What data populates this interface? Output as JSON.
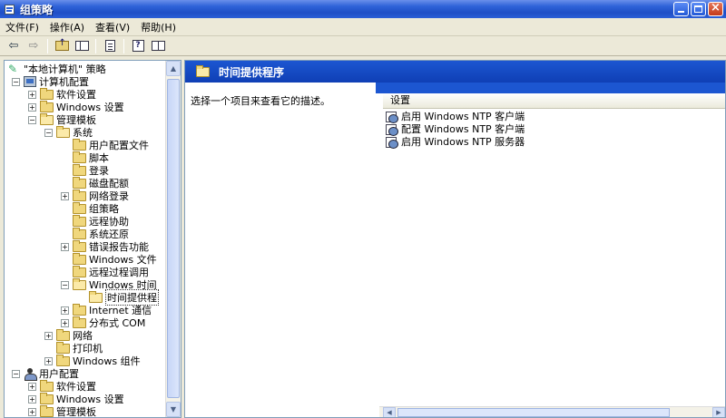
{
  "window": {
    "title": "组策略"
  },
  "menu": [
    "文件(F)",
    "操作(A)",
    "查看(V)",
    "帮助(H)"
  ],
  "toolbar": {
    "back_icon": "back-arrow-icon",
    "forward_icon": "forward-arrow-icon",
    "back_glyph": "⇦",
    "forward_glyph": "⇨"
  },
  "tree": [
    {
      "label": "\"本地计算机\" 策略",
      "icon": "policy"
    },
    {
      "label": "计算机配置",
      "icon": "computer"
    },
    {
      "label": "软件设置",
      "icon": "folder"
    },
    {
      "label": "Windows 设置",
      "icon": "folder"
    },
    {
      "label": "管理模板",
      "icon": "folder"
    },
    {
      "label": "系统",
      "icon": "folder"
    },
    {
      "label": "用户配置文件",
      "icon": "folder"
    },
    {
      "label": "脚本",
      "icon": "folder"
    },
    {
      "label": "登录",
      "icon": "folder"
    },
    {
      "label": "磁盘配额",
      "icon": "folder"
    },
    {
      "label": "网络登录",
      "icon": "folder"
    },
    {
      "label": "组策略",
      "icon": "folder"
    },
    {
      "label": "远程协助",
      "icon": "folder"
    },
    {
      "label": "系统还原",
      "icon": "folder"
    },
    {
      "label": "错误报告功能",
      "icon": "folder"
    },
    {
      "label": "Windows 文件",
      "icon": "folder"
    },
    {
      "label": "远程过程调用",
      "icon": "folder"
    },
    {
      "label": "Windows 时间",
      "icon": "folder"
    },
    {
      "label": "时间提供程",
      "icon": "folder-open"
    },
    {
      "label": "Internet 通信",
      "icon": "folder"
    },
    {
      "label": "分布式 COM",
      "icon": "folder"
    },
    {
      "label": "网络",
      "icon": "folder"
    },
    {
      "label": "打印机",
      "icon": "folder"
    },
    {
      "label": "Windows 组件",
      "icon": "folder"
    },
    {
      "label": "用户配置",
      "icon": "user"
    },
    {
      "label": "软件设置",
      "icon": "folder"
    },
    {
      "label": "Windows 设置",
      "icon": "folder"
    },
    {
      "label": "管理模板",
      "icon": "folder"
    }
  ],
  "right": {
    "header_title": "时间提供程序",
    "description": "选择一个项目来查看它的描述。",
    "column_header": "设置",
    "settings": [
      "启用 Windows NTP 客户端",
      "配置 Windows NTP 客户端",
      "启用 Windows NTP 服务器"
    ]
  }
}
